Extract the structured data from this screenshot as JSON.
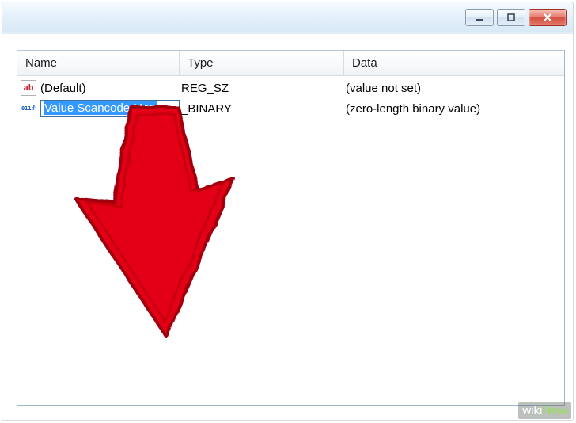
{
  "columns": {
    "name": "Name",
    "type": "Type",
    "data": "Data"
  },
  "rows": [
    {
      "icon": "string",
      "name": "(Default)",
      "type": "REG_SZ",
      "data": "(value not set)",
      "editing": false
    },
    {
      "icon": "binary",
      "name": "Value Scancode Map",
      "type_suffix": "_BINARY",
      "data": "(zero-length binary value)",
      "editing": true
    }
  ],
  "watermark": {
    "wiki": "wiki",
    "how": "How"
  }
}
